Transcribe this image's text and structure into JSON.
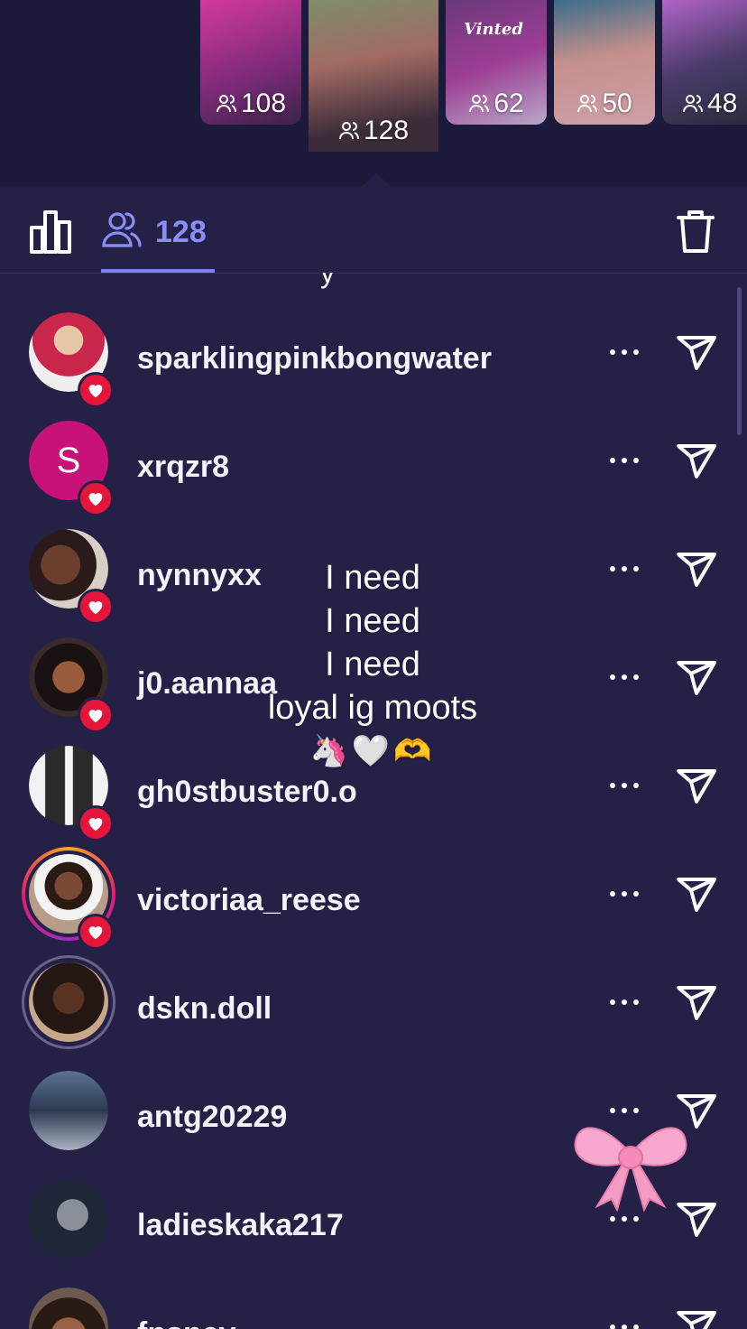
{
  "stories": [
    {
      "viewers": "108"
    },
    {
      "viewers": "128",
      "selected": true
    },
    {
      "viewers": "62",
      "text": "Vinted"
    },
    {
      "viewers": "50"
    },
    {
      "viewers": "48"
    }
  ],
  "tabs": {
    "viewer_count": "128"
  },
  "partial_text": "y",
  "viewers": [
    {
      "username": "sparklingpinkbongwater",
      "liked": true
    },
    {
      "username": "xrqzr8",
      "initial": "S",
      "liked": true
    },
    {
      "username": "nynnyxx",
      "liked": true
    },
    {
      "username": "j0.aannaa",
      "liked": true
    },
    {
      "username": "gh0stbuster0.o",
      "liked": true
    },
    {
      "username": "victoriaa_reese",
      "liked": true,
      "story_ring": true
    },
    {
      "username": "dskn.doll",
      "liked": false,
      "story_ring": true
    },
    {
      "username": "antg20229",
      "liked": false
    },
    {
      "username": "ladieskaka217",
      "liked": false
    },
    {
      "username": "fpsnev",
      "liked": false
    }
  ],
  "overlay": {
    "line1": "I need",
    "line2": "I need",
    "line3": "I need",
    "line4": "loyal ig moots",
    "emojis": "🦄🤍🫶"
  },
  "colors": {
    "background": "#252046",
    "accent": "#8a8ff7",
    "like_heart": "#e6163b"
  },
  "icons": [
    "bar-chart-icon",
    "viewers-icon",
    "trash-icon",
    "more-icon",
    "send-icon",
    "heart-icon",
    "bow-sticker-icon"
  ]
}
